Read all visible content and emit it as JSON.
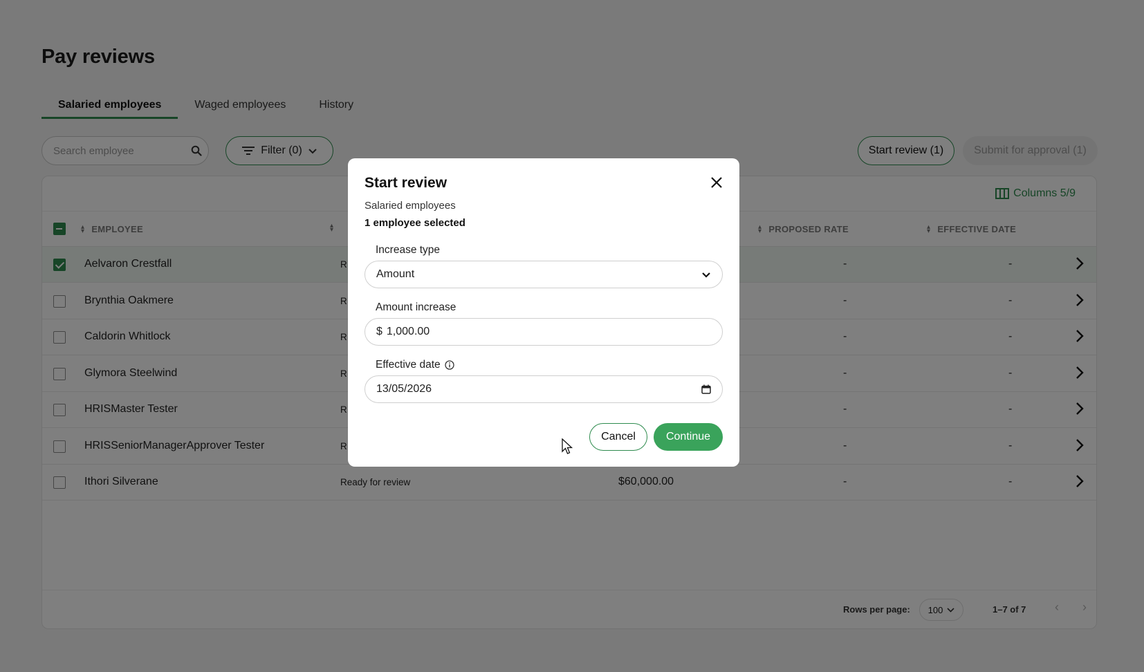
{
  "page": {
    "title": "Pay reviews"
  },
  "tabs": [
    {
      "label": "Salaried employees",
      "active": true
    },
    {
      "label": "Waged employees",
      "active": false
    },
    {
      "label": "History",
      "active": false
    }
  ],
  "toolbar": {
    "search_placeholder": "Search employee",
    "filter_label": "Filter (0)",
    "start_review_label": "Start review (1)",
    "submit_label": "Submit for approval (1)",
    "columns_label": "Columns 5/9"
  },
  "table": {
    "columns": [
      "EMPLOYEE",
      "PROPOSED RATE",
      "EFFECTIVE DATE"
    ],
    "rows": [
      {
        "name": "Aelvaron Crestfall",
        "status": "R",
        "rate": "",
        "proposed": "-",
        "effective": "-",
        "checked": true
      },
      {
        "name": "Brynthia Oakmere",
        "status": "R",
        "rate": "",
        "proposed": "-",
        "effective": "-",
        "checked": false
      },
      {
        "name": "Caldorin Whitlock",
        "status": "R",
        "rate": "",
        "proposed": "-",
        "effective": "-",
        "checked": false
      },
      {
        "name": "Glymora Steelwind",
        "status": "R",
        "rate": "",
        "proposed": "-",
        "effective": "-",
        "checked": false
      },
      {
        "name": "HRISMaster Tester",
        "status": "R",
        "rate": "",
        "proposed": "-",
        "effective": "-",
        "checked": false
      },
      {
        "name": "HRISSeniorManagerApprover Tester",
        "status": "R",
        "rate": "",
        "proposed": "-",
        "effective": "-",
        "checked": false
      },
      {
        "name": "Ithori Silverane",
        "status": "Ready for review",
        "rate": "$60,000.00",
        "proposed": "-",
        "effective": "-",
        "checked": false
      }
    ]
  },
  "footer": {
    "rows_per_page_label": "Rows per page:",
    "rows_per_page_value": "100",
    "range": "1–7 of 7"
  },
  "modal": {
    "title": "Start review",
    "subtitle": "Salaried employees",
    "selection": "1 employee selected",
    "increase_type_label": "Increase type",
    "increase_type_value": "Amount",
    "amount_label": "Amount increase",
    "currency": "$",
    "amount_value": "1,000.00",
    "effective_date_label": "Effective date",
    "effective_date_value": "13/05/2026",
    "cancel_label": "Cancel",
    "continue_label": "Continue"
  },
  "colors": {
    "accent": "#2e8b4e",
    "continue": "#3aa35b",
    "overlay": "rgba(0,0,0,0.5)"
  }
}
